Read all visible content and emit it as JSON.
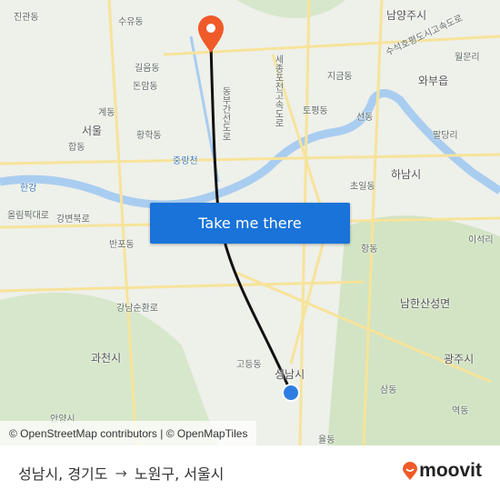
{
  "map": {
    "labels": [
      "진관동",
      "수유동",
      "남양주시",
      "길음동",
      "돈암동",
      "서울",
      "계동",
      "황학동",
      "합동",
      "중랑천",
      "한강",
      "올림픽대로",
      "강변북로",
      "반포동",
      "강남순환로",
      "과천시",
      "고등동",
      "성남시",
      "삼동",
      "광주시",
      "역동",
      "하남시",
      "초일동",
      "남한산성면",
      "이석리",
      "와부읍",
      "월문리",
      "팔당리",
      "지금동",
      "토평동",
      "선동",
      "항동",
      "안양시",
      "율동",
      "동부간선도로",
      "세종포천고속도로",
      "수석호평도시고속도로"
    ],
    "colors": {
      "route": "#111111",
      "destination_pin": "#f05a28",
      "origin_dot": "#2f7de1",
      "water": "#a9cdf0",
      "park": "#cfe2c1",
      "road": "#f7e39a"
    }
  },
  "cta": {
    "label": "Take me there"
  },
  "attribution": "© OpenStreetMap contributors | © OpenMapTiles",
  "footer": {
    "origin": "성남시, 경기도",
    "arrow": "→",
    "destination": "노원구, 서울시",
    "brand": "moovit"
  }
}
